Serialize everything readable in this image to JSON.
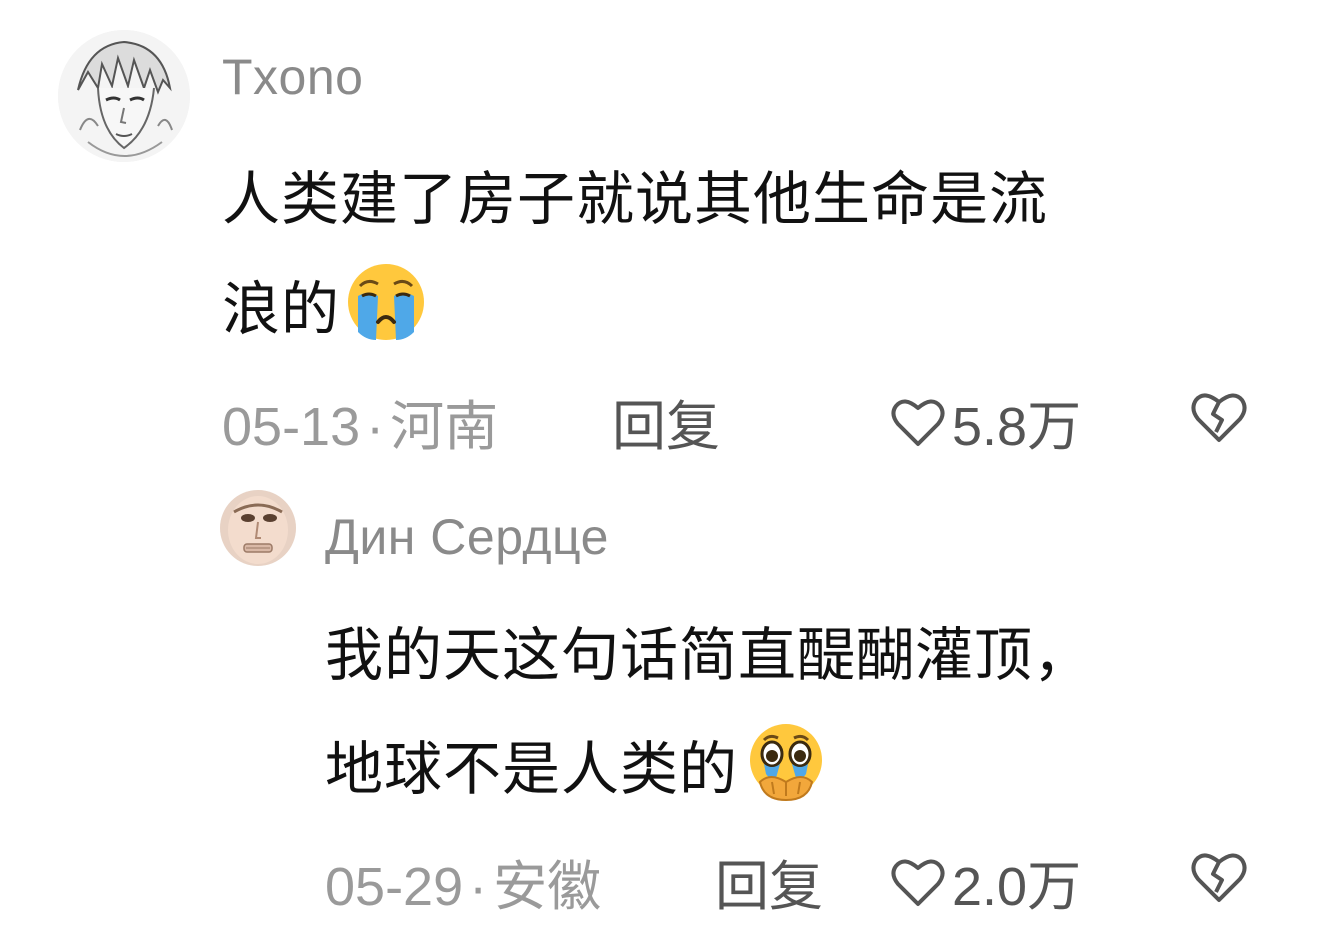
{
  "comments": [
    {
      "username": "Txono",
      "avatar_icon": "sketch-portrait-avatar",
      "text_line1": "人类建了房子就说其他生命是流",
      "text_line2": "浪的",
      "emoji": "loudly-crying-face-emoji",
      "date": "05-13",
      "location": "河南",
      "reply_label": "回复",
      "like_icon": "heart-outline-icon",
      "like_count": "5.8万",
      "dislike_icon": "broken-heart-outline-icon"
    },
    {
      "username": "Дин Сердце",
      "avatar_icon": "face-photo-avatar",
      "text_line1": "我的天这句话简直醍醐灌顶，",
      "text_line2": "地球不是人类的",
      "emoji": "face-holding-back-tears-emoji",
      "date": "05-29",
      "location": "安徽",
      "reply_label": "回复",
      "like_icon": "heart-outline-icon",
      "like_count": "2.0万",
      "dislike_icon": "broken-heart-outline-icon"
    }
  ],
  "colors": {
    "username": "#8a8a8a",
    "body_text": "#111111",
    "meta_text": "#9a9a9a",
    "action_text": "#555555",
    "emoji_face": "#FFC83D",
    "tear_blue": "#4FA8E8"
  }
}
